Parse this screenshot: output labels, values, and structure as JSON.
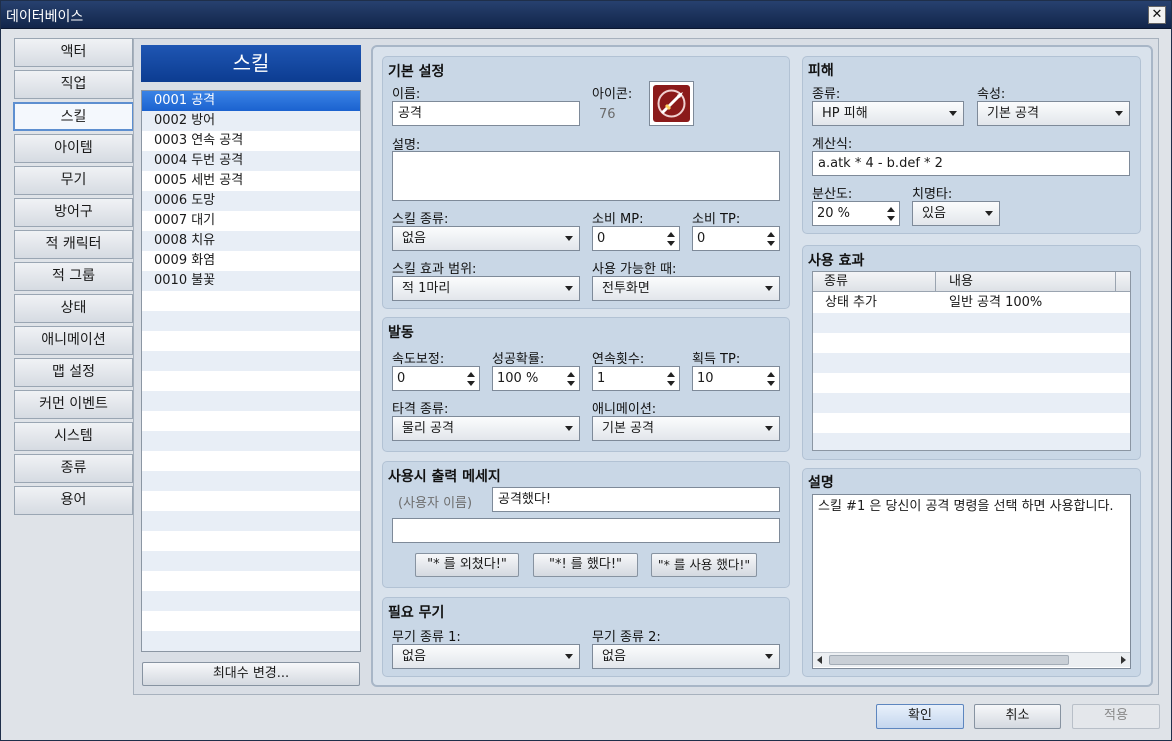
{
  "window": {
    "title": "데이터베이스",
    "close_glyph": "✕"
  },
  "categories": [
    "액터",
    "직업",
    "스킬",
    "아이템",
    "무기",
    "방어구",
    "적 캐릭터",
    "적 그룹",
    "상태",
    "애니메이션",
    "맵 설정",
    "커먼 이벤트",
    "시스템",
    "종류",
    "용어"
  ],
  "active_category": "스킬",
  "skills_list": {
    "header": "스킬",
    "items": [
      "0001 공격",
      "0002 방어",
      "0003 연속 공격",
      "0004 두번 공격",
      "0005 세번 공격",
      "0006 도망",
      "0007 대기",
      "0008 치유",
      "0009 화염",
      "0010 불꽃"
    ],
    "selected_index": 0,
    "max_button": "최대수 변경..."
  },
  "basic": {
    "title": "기본 설정",
    "name_label": "이름:",
    "name_value": "공격",
    "icon_label": "아이콘:",
    "icon_index": "76",
    "icon_name": "sword-attack-icon",
    "desc_label": "설명:",
    "desc_value": "",
    "skill_type_label": "스킬 종류:",
    "skill_type_value": "없음",
    "mp_label": "소비 MP:",
    "mp_value": "0",
    "tp_label": "소비 TP:",
    "tp_value": "0",
    "scope_label": "스킬 효과 범위:",
    "scope_value": "적 1마리",
    "occasion_label": "사용 가능한 때:",
    "occasion_value": "전투화면"
  },
  "invocation": {
    "title": "발동",
    "speed_label": "속도보정:",
    "speed_value": "0",
    "success_label": "성공확률:",
    "success_value": "100 %",
    "repeat_label": "연속횟수:",
    "repeat_value": "1",
    "tp_gain_label": "획득 TP:",
    "tp_gain_value": "10",
    "hit_type_label": "타격 종류:",
    "hit_type_value": "물리 공격",
    "animation_label": "애니메이션:",
    "animation_value": "기본 공격"
  },
  "message": {
    "title": "사용시 출력 메세지",
    "user_name": "(사용자 이름)",
    "line1": "공격했다!",
    "line2": "",
    "btn1": "\"* 를 외쳤다!\"",
    "btn2": "\"*! 를 했다!\"",
    "btn3": "\"* 를 사용 했다!\""
  },
  "weapons": {
    "title": "필요 무기",
    "type1_label": "무기 종류 1:",
    "type1_value": "없음",
    "type2_label": "무기 종류 2:",
    "type2_value": "없음"
  },
  "damage": {
    "title": "피해",
    "type_label": "종류:",
    "type_value": "HP 피해",
    "element_label": "속성:",
    "element_value": "기본 공격",
    "formula_label": "계산식:",
    "formula_value": "a.atk * 4 - b.def * 2",
    "variance_label": "분산도:",
    "variance_value": "20 %",
    "critical_label": "치명타:",
    "critical_value": "있음"
  },
  "effects": {
    "title": "사용 효과",
    "col_type": "종류",
    "col_content": "내용",
    "rows": [
      {
        "type": "상태 추가",
        "content": "일반 공격 100%"
      }
    ]
  },
  "note": {
    "title": "설명",
    "text": "스킬 #1 은 당신이 공격 명령을 선택 하면 사용합니다."
  },
  "footer": {
    "ok": "확인",
    "cancel": "취소",
    "apply": "적용"
  }
}
